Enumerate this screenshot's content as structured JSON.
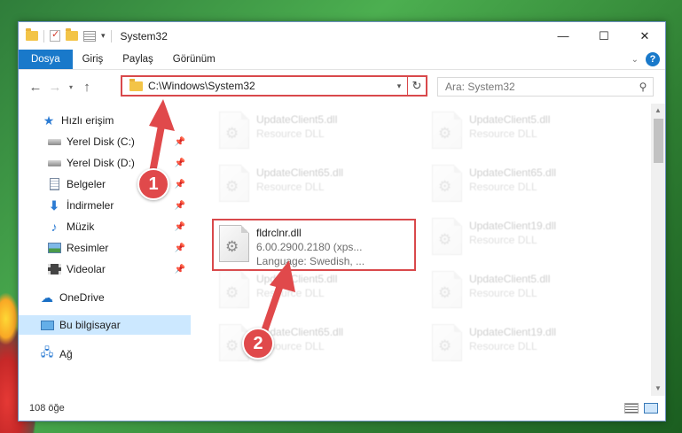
{
  "titlebar": {
    "title": "System32",
    "minimize": "—",
    "maximize": "☐",
    "close": "✕"
  },
  "ribbon": {
    "tabs": [
      "Dosya",
      "Giriş",
      "Paylaş",
      "Görünüm"
    ]
  },
  "address": {
    "path": "C:\\Windows\\System32",
    "search_placeholder": "Ara: System32"
  },
  "sidebar": {
    "items": [
      {
        "label": "Hızlı erişim",
        "icon": "star-icon"
      },
      {
        "label": "Yerel Disk (C:)",
        "icon": "drive-icon",
        "pinned": true
      },
      {
        "label": "Yerel Disk (D:)",
        "icon": "drive-icon",
        "pinned": true
      },
      {
        "label": "Belgeler",
        "icon": "document-icon",
        "pinned": true
      },
      {
        "label": "İndirmeler",
        "icon": "download-icon",
        "pinned": true
      },
      {
        "label": "Müzik",
        "icon": "music-icon",
        "pinned": true
      },
      {
        "label": "Resimler",
        "icon": "pictures-icon",
        "pinned": true
      },
      {
        "label": "Videolar",
        "icon": "videos-icon",
        "pinned": true
      },
      {
        "label": "OneDrive",
        "icon": "cloud-icon"
      },
      {
        "label": "Bu bilgisayar",
        "icon": "computer-icon",
        "selected": true
      },
      {
        "label": "Ağ",
        "icon": "network-icon"
      }
    ]
  },
  "files": {
    "highlighted": {
      "name": "fldrclnr.dll",
      "version": "6.00.2900.2180 (xps...",
      "language": "Language: Swedish, ..."
    },
    "faded": [
      {
        "name": "UpdateClient5.dll",
        "desc": "Resource DLL"
      },
      {
        "name": "UpdateClient5.dll",
        "desc": "Resource DLL"
      },
      {
        "name": "UpdateClient65.dll",
        "desc": "Resource DLL"
      },
      {
        "name": "UpdateClient65.dll",
        "desc": "Resource DLL"
      },
      {
        "name": "UpdateClient19.dll",
        "desc": "Resource DLL"
      },
      {
        "name": "UpdateClient5.dll",
        "desc": "Resource DLL"
      },
      {
        "name": "UpdateClient5.dll",
        "desc": "Resource DLL"
      },
      {
        "name": "UpdateClient65.dll",
        "desc": "Resource DLL"
      },
      {
        "name": "UpdateClient19.dll",
        "desc": "Resource DLL"
      }
    ]
  },
  "status": {
    "item_count": "108 öğe"
  },
  "annotations": {
    "step1": "1",
    "step2": "2",
    "color": "#e0494b"
  }
}
